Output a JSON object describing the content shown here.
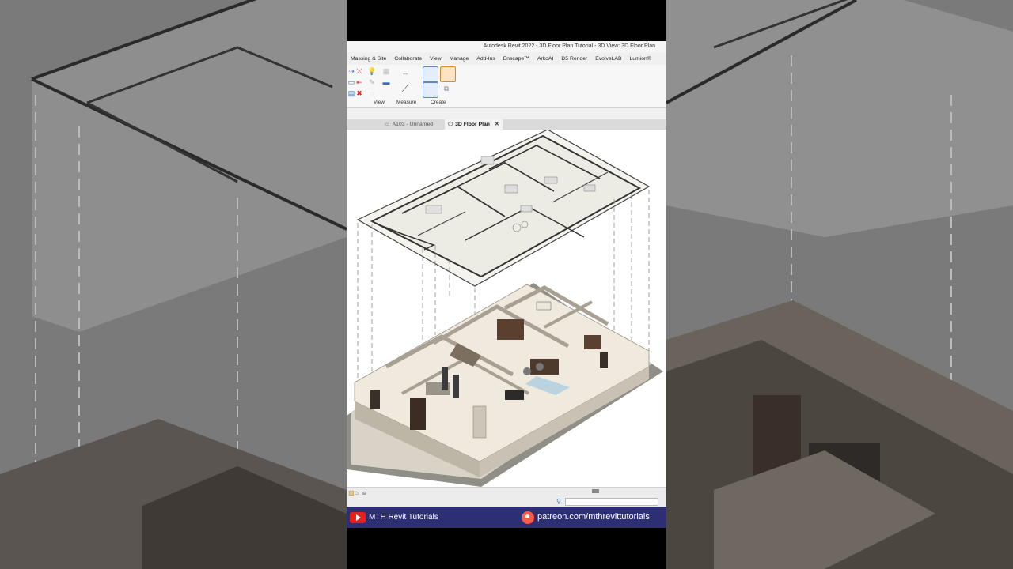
{
  "app": {
    "window_title": "Autodesk Revit 2022 - 3D Floor Plan Tutorial - 3D View: 3D Floor Plan"
  },
  "menu": {
    "items": [
      "Massing & Site",
      "Collaborate",
      "View",
      "Manage",
      "Add-Ins",
      "Enscape™",
      "ArkoAI",
      "D5 Render",
      "EvolveLAB",
      "Lumion®"
    ]
  },
  "ribbon": {
    "groups": {
      "view": "View",
      "measure": "Measure",
      "create": "Create"
    }
  },
  "tabs": {
    "items": [
      {
        "label": "A103 - Unnamed",
        "icon": "sheet-icon",
        "active": false
      },
      {
        "label": "3D Floor Plan",
        "icon": "3d-view-icon",
        "active": true
      }
    ],
    "close_glyph": "✕"
  },
  "banner": {
    "youtube_label": "MTH Revit Tutorials",
    "patreon_label": "patreon.com/mthrevittutorials",
    "colors": {
      "background": "#2e2e74",
      "youtube": "#e62117",
      "patreon": "#ff5a48"
    }
  },
  "colors": {
    "viewport": "#ffffff",
    "ribbon_accent": "#3b6fb4",
    "wall": "#e6dfd3",
    "floor": "#d9d3c7"
  }
}
